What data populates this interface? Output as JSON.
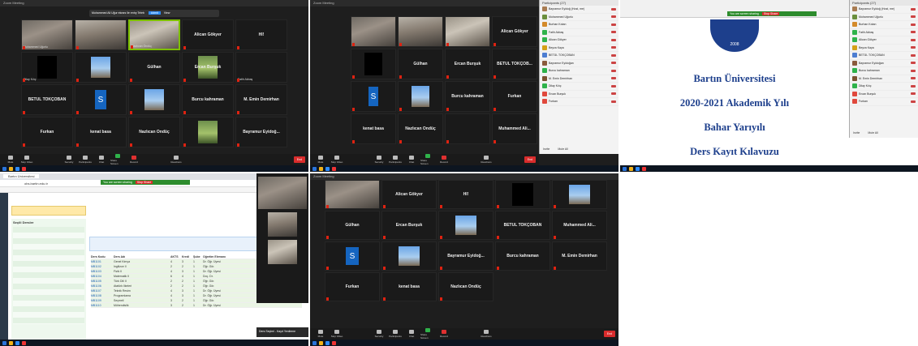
{
  "panel1": {
    "banner": "Muhammed Ali Uğur ekranı ile entry Teleb",
    "banner_btn": "Admit",
    "banner_btn2": "View",
    "tiles": [
      {
        "caption": "Muhammed Uğurlu",
        "name": ""
      },
      {
        "caption": "",
        "name": ""
      },
      {
        "caption": "Nazlıcan Öndüç",
        "name": ""
      },
      {
        "caption": "",
        "name": "Alican Gökyer"
      },
      {
        "caption": "",
        "name": "Hİ!"
      },
      {
        "caption": "Dilay Kılıç",
        "name": ""
      },
      {
        "caption": "",
        "name": ""
      },
      {
        "caption": "",
        "name": "Gülhan"
      },
      {
        "caption": "",
        "name": "Ercan Burşuk"
      },
      {
        "caption": "Fatih Akbaş",
        "name": ""
      },
      {
        "caption": "",
        "name": "BETÜL TOKÇOBAN"
      },
      {
        "caption": "",
        "name": ""
      },
      {
        "caption": "",
        "name": ""
      },
      {
        "caption": "",
        "name": "Burcu kahraman"
      },
      {
        "caption": "",
        "name": "M. Emin Demirhan"
      },
      {
        "caption": "",
        "name": "Furkan"
      },
      {
        "caption": "",
        "name": "kenat basa"
      },
      {
        "caption": "",
        "name": "Nazlıcan Öndüç"
      },
      {
        "caption": "",
        "name": ""
      },
      {
        "caption": "",
        "name": "Bayramur Eyidoğ..."
      }
    ],
    "toolbar": [
      "Mute",
      "Stop Video",
      "Security",
      "Participants",
      "Chat",
      "Share Screen",
      "Record",
      "Reactions"
    ],
    "end": "End"
  },
  "panel2": {
    "tiles": [
      {
        "caption": "",
        "name": ""
      },
      {
        "caption": "",
        "name": ""
      },
      {
        "caption": "",
        "name": ""
      },
      {
        "caption": "",
        "name": "Alican Gökyer"
      },
      {
        "caption": "",
        "name": ""
      },
      {
        "caption": "",
        "name": "Gülhan"
      },
      {
        "caption": "",
        "name": "Ercan Burşuk"
      },
      {
        "caption": "",
        "name": "BETÜL TOKÇOB..."
      },
      {
        "caption": "",
        "name": ""
      },
      {
        "caption": "",
        "name": ""
      },
      {
        "caption": "",
        "name": "Burcu kahraman"
      },
      {
        "caption": "",
        "name": "Furkan"
      },
      {
        "caption": "",
        "name": "kenat basa"
      },
      {
        "caption": "",
        "name": "Nazlıcan Öndüç"
      },
      {
        "caption": "",
        "name": ""
      },
      {
        "caption": "",
        "name": "Muhammed Ali..."
      }
    ],
    "participants_title": "Participants (27)",
    "participants": [
      "Bayramur Eyidoğ (Host, me)",
      "Muhammed Uğurlu",
      "Burhan Kotan",
      "Fatih Akbaş",
      "Alican Gökyer",
      "Beyza Kaya",
      "BETÜL TOKÇOBAN",
      "Bayramur Eyidoğan",
      "Burcu kahraman",
      "M. Emin Demirhan",
      "Dilay Kılıç",
      "Ercan Burşuk",
      "Furkan"
    ],
    "invite": "Invite",
    "mute_all": "Mute All"
  },
  "panel3": {
    "slide": {
      "l1": "Bartın Üniversitesi",
      "l2": "2020-2021 Akademik Yılı",
      "l3": "Bahar Yarıyılı",
      "l4": "Ders Kayıt Kılavuzu",
      "logo_year": "2008"
    },
    "share": "You are screen sharing",
    "stop": "Stop Share",
    "participants_title": "Participants (27)",
    "participants": [
      "Bayramur Eyidoğ (Host, me)",
      "Muhammed Uğurlu",
      "Burhan Kotan",
      "Fatih Akbaş",
      "Alican Gökyer",
      "Beyza Kaya",
      "BETÜL TOKÇOBAN",
      "Bayramur Eyidoğan",
      "Burcu kahraman",
      "M. Emin Demirhan",
      "Dilay Kılıç",
      "Ercan Burşuk",
      "Furkan"
    ],
    "invite": "Invite",
    "mute_all": "Mute All"
  },
  "panel4": {
    "tab": "Bartın Üniversitesi",
    "url": "obs.bartin.edu.tr",
    "share": "You are screen sharing",
    "stop": "Stop Share",
    "left_title": "Seçili Dersler",
    "right_header": [
      "Ders Kodu",
      "Ders Adı",
      "AKTS",
      "Kredi",
      "Şube",
      "Öğretim Elemanı"
    ],
    "rows": [
      [
        "MB1101",
        "Genel Kimya",
        "4",
        "3",
        "1",
        "Dr. Öğr. Üyesi"
      ],
      [
        "MB1102",
        "İngilizce II",
        "2",
        "2",
        "1",
        "Öğr. Gör."
      ],
      [
        "MB1103",
        "Fizik II",
        "4",
        "3",
        "1",
        "Dr. Öğr. Üyesi"
      ],
      [
        "MB1104",
        "Matematik II",
        "6",
        "4",
        "1",
        "Doç. Dr."
      ],
      [
        "MB1105",
        "Türk Dili II",
        "2",
        "2",
        "1",
        "Öğr. Gör."
      ],
      [
        "MB1106",
        "Atatürk İlkeleri",
        "2",
        "2",
        "1",
        "Öğr. Gör."
      ],
      [
        "MB1107",
        "Teknik Resim",
        "4",
        "3",
        "1",
        "Dr. Öğr. Üyesi"
      ],
      [
        "MB1108",
        "Programlama",
        "4",
        "3",
        "1",
        "Dr. Öğr. Üyesi"
      ],
      [
        "MB1109",
        "Seçmeli",
        "3",
        "2",
        "1",
        "Öğr. Gör."
      ],
      [
        "MB1110",
        "Mühendislik",
        "3",
        "2",
        "1",
        "Dr. Öğr. Üyesi"
      ]
    ],
    "video_label": "Ders Seçimi - Kayıt Yenileme"
  },
  "panel5": {
    "tiles": [
      {
        "caption": "",
        "name": ""
      },
      {
        "caption": "",
        "name": "Alican Gökyer"
      },
      {
        "caption": "",
        "name": "Hİ!"
      },
      {
        "caption": "",
        "name": ""
      },
      {
        "caption": "",
        "name": ""
      },
      {
        "caption": "",
        "name": "Gülhan"
      },
      {
        "caption": "",
        "name": "Ercan Burşuk"
      },
      {
        "caption": "",
        "name": ""
      },
      {
        "caption": "",
        "name": "BETÜL TOKÇOBAN"
      },
      {
        "caption": "",
        "name": "Muhammed Ali..."
      },
      {
        "caption": "",
        "name": ""
      },
      {
        "caption": "",
        "name": ""
      },
      {
        "caption": "",
        "name": "Bayramur Eyidoğ..."
      },
      {
        "caption": "",
        "name": "Burcu kahraman"
      },
      {
        "caption": "",
        "name": "M. Emin Demirhan"
      },
      {
        "caption": "",
        "name": "Furkan"
      },
      {
        "caption": "",
        "name": "kenat basa"
      },
      {
        "caption": "",
        "name": "Nazlıcan Öndüç"
      }
    ]
  }
}
